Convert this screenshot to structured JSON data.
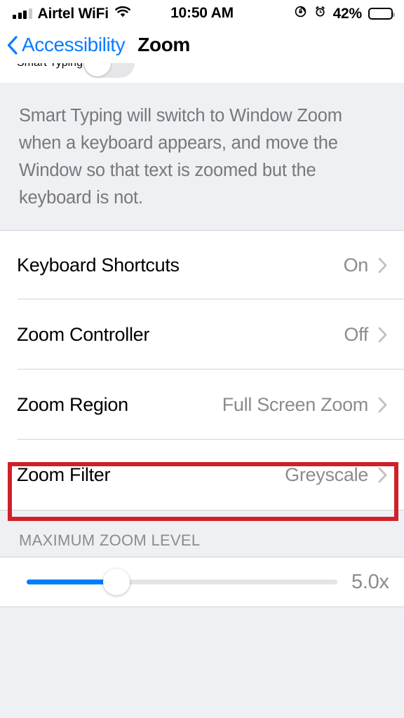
{
  "status_bar": {
    "carrier": "Airtel WiFi",
    "time": "10:50 AM",
    "battery_percent": "42%",
    "signal_bars_filled": 3,
    "signal_bars_total": 4,
    "icons": [
      "signal-bars-icon",
      "wifi-icon",
      "rotation-lock-icon",
      "alarm-clock-icon",
      "battery-icon"
    ]
  },
  "nav_bar": {
    "back_label": "Accessibility",
    "title": "Zoom"
  },
  "clipped_row": {
    "label": "Smart Typing",
    "toggle_state": "off"
  },
  "footer_note": "Smart Typing will switch to Window Zoom when a keyboard appears, and move the Window so that text is zoomed but the keyboard is not.",
  "rows": [
    {
      "label": "Keyboard Shortcuts",
      "value": "On",
      "accessory": "chevron-right-icon"
    },
    {
      "label": "Zoom Controller",
      "value": "Off",
      "accessory": "chevron-right-icon"
    },
    {
      "label": "Zoom Region",
      "value": "Full Screen Zoom",
      "accessory": "chevron-right-icon"
    },
    {
      "label": "Zoom Filter",
      "value": "Greyscale",
      "accessory": "chevron-right-icon"
    }
  ],
  "max_zoom_section": {
    "header": "MAXIMUM ZOOM LEVEL",
    "slider_value_label": "5.0x",
    "slider_fill_percent": 29
  },
  "annotation": {
    "type": "rectangle-highlight",
    "target": "Zoom Filter",
    "color": "#d0202a"
  },
  "colors": {
    "accent_blue": "#007aff",
    "link_blue": "#0a7cff",
    "background": "#eff0f4",
    "cell": "#ffffff",
    "secondary_text": "#8b8b90",
    "highlight_red": "#d0202a"
  }
}
